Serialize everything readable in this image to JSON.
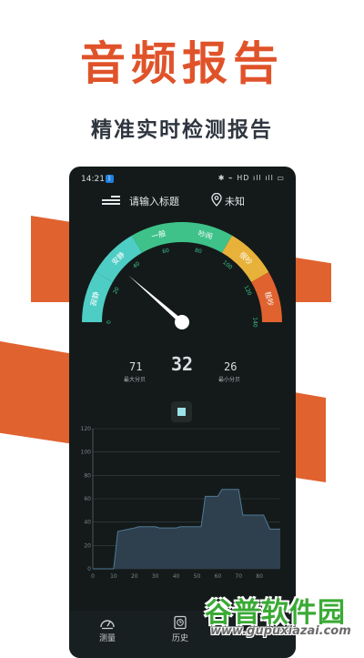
{
  "promo": {
    "title": "音频报告",
    "subtitle": "精准实时检测报告"
  },
  "colors": {
    "accent": "#e0532a",
    "stripe": "#e0622f",
    "phone_bg": "#141a1a",
    "chart_fill": "#2e3f4e",
    "watermark": "#3aaa35"
  },
  "status_bar": {
    "time": "14:21",
    "bt_badge": "ᛒ",
    "icons": "✱ ⌁ HD ıll ıll ▭"
  },
  "app_bar": {
    "title_placeholder": "请输入标题",
    "location": "未知"
  },
  "gauge": {
    "bands": [
      {
        "label": "寂静",
        "color": "#4ecdc4"
      },
      {
        "label": "安静",
        "color": "#4ecdc4"
      },
      {
        "label": "一般",
        "color": "#3ec28a"
      },
      {
        "label": "吵闹",
        "color": "#3ec28a"
      },
      {
        "label": "很吵",
        "color": "#e8b23a"
      },
      {
        "label": "极吵",
        "color": "#e0622f"
      }
    ],
    "ticks": [
      "0",
      "20",
      "40",
      "60",
      "80",
      "100",
      "120",
      "140"
    ],
    "min": 0,
    "max": 140,
    "value": 32
  },
  "readings": {
    "max_value": "71",
    "max_label": "最大分贝",
    "current": "32",
    "min_value": "26",
    "min_label": "最小分贝"
  },
  "chart_data": {
    "type": "area",
    "x": [
      0,
      10,
      12,
      20,
      22,
      30,
      32,
      40,
      42,
      50,
      52,
      54,
      60,
      62,
      70,
      72,
      80,
      82,
      85,
      90
    ],
    "values": [
      0,
      0,
      32,
      35,
      36,
      36,
      35,
      35,
      36,
      36,
      36,
      62,
      62,
      68,
      68,
      46,
      46,
      46,
      34,
      34
    ],
    "x_ticks": [
      "0",
      "10",
      "20",
      "30",
      "40",
      "50",
      "60",
      "70",
      "80"
    ],
    "y_ticks": [
      "0",
      "20",
      "40",
      "60",
      "80",
      "100",
      "120"
    ],
    "xlim": [
      0,
      90
    ],
    "ylim": [
      0,
      120
    ],
    "grid": true
  },
  "tabs": [
    {
      "label": "测量",
      "icon": "gauge-icon"
    },
    {
      "label": "历史",
      "icon": "history-icon"
    }
  ],
  "watermark": {
    "main": "谷普软件园",
    "url": "www.gupuxiazai.com"
  }
}
